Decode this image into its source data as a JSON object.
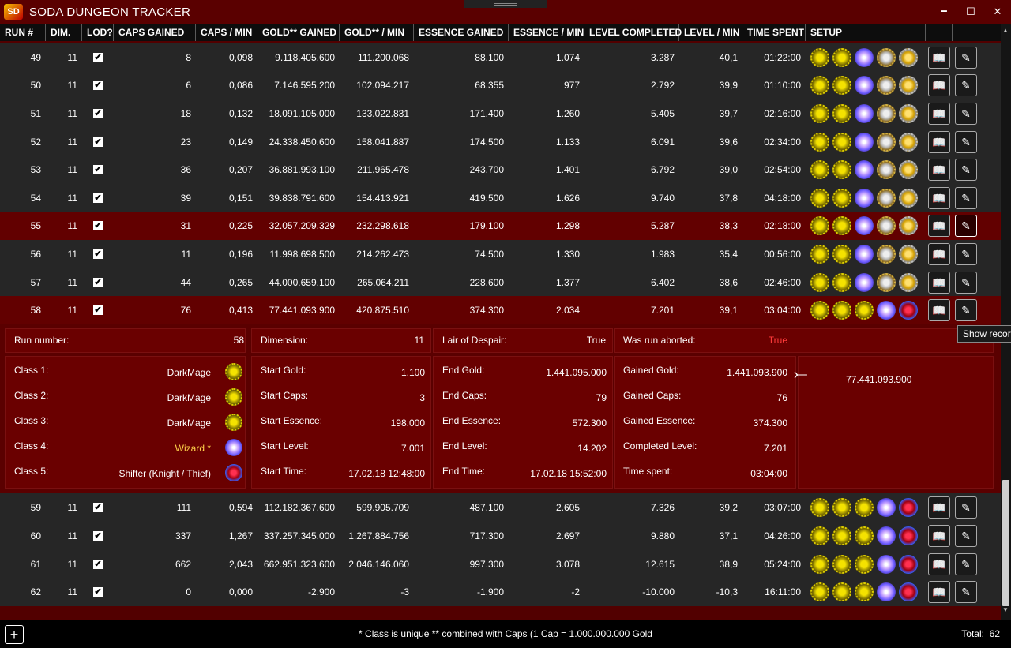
{
  "app": {
    "title": "SODA DUNGEON TRACKER",
    "logo": "SD"
  },
  "window": {
    "minimize": "🗕",
    "maximize": "☐",
    "close": "✕"
  },
  "columns": [
    "RUN #",
    "DIM.",
    "LOD?",
    "CAPS GAINED",
    "CAPS / MIN",
    "GOLD** GAINED",
    "GOLD** / MIN",
    "ESSENCE GAINED",
    "ESSENCE / MIN",
    "LEVEL COMPLETED",
    "LEVEL / MIN",
    "TIME SPENT",
    "SETUP"
  ],
  "rows": [
    {
      "run": "49",
      "dim": "11",
      "lod": true,
      "caps": "8",
      "caps_min": "0,098",
      "gold": "9.118.405.600",
      "gold_min": "111.200.068",
      "ess": "88.100",
      "ess_min": "1.074",
      "level": "3.287",
      "level_min": "40,1",
      "time": "01:22:00",
      "setup": [
        "gear",
        "gear",
        "orb",
        "shield",
        "wing"
      ]
    },
    {
      "run": "50",
      "dim": "11",
      "lod": true,
      "caps": "6",
      "caps_min": "0,086",
      "gold": "7.146.595.200",
      "gold_min": "102.094.217",
      "ess": "68.355",
      "ess_min": "977",
      "level": "2.792",
      "level_min": "39,9",
      "time": "01:10:00",
      "setup": [
        "gear",
        "gear",
        "orb",
        "shield",
        "wing"
      ]
    },
    {
      "run": "51",
      "dim": "11",
      "lod": true,
      "caps": "18",
      "caps_min": "0,132",
      "gold": "18.091.105.000",
      "gold_min": "133.022.831",
      "ess": "171.400",
      "ess_min": "1.260",
      "level": "5.405",
      "level_min": "39,7",
      "time": "02:16:00",
      "setup": [
        "gear",
        "gear",
        "orb",
        "shield",
        "wing"
      ]
    },
    {
      "run": "52",
      "dim": "11",
      "lod": true,
      "caps": "23",
      "caps_min": "0,149",
      "gold": "24.338.450.600",
      "gold_min": "158.041.887",
      "ess": "174.500",
      "ess_min": "1.133",
      "level": "6.091",
      "level_min": "39,6",
      "time": "02:34:00",
      "setup": [
        "gear",
        "gear",
        "orb",
        "shield",
        "wing"
      ]
    },
    {
      "run": "53",
      "dim": "11",
      "lod": true,
      "caps": "36",
      "caps_min": "0,207",
      "gold": "36.881.993.100",
      "gold_min": "211.965.478",
      "ess": "243.700",
      "ess_min": "1.401",
      "level": "6.792",
      "level_min": "39,0",
      "time": "02:54:00",
      "setup": [
        "gear",
        "gear",
        "orb",
        "shield",
        "wing"
      ]
    },
    {
      "run": "54",
      "dim": "11",
      "lod": true,
      "caps": "39",
      "caps_min": "0,151",
      "gold": "39.838.791.600",
      "gold_min": "154.413.921",
      "ess": "419.500",
      "ess_min": "1.626",
      "level": "9.740",
      "level_min": "37,8",
      "time": "04:18:00",
      "setup": [
        "gear",
        "gear",
        "orb",
        "shield",
        "wing"
      ]
    },
    {
      "run": "55",
      "dim": "11",
      "lod": true,
      "caps": "31",
      "caps_min": "0,225",
      "gold": "32.057.209.329",
      "gold_min": "232.298.618",
      "ess": "179.100",
      "ess_min": "1.298",
      "level": "5.287",
      "level_min": "38,3",
      "time": "02:18:00",
      "setup": [
        "gear",
        "gear",
        "orb",
        "shield",
        "wing"
      ]
    },
    {
      "run": "56",
      "dim": "11",
      "lod": true,
      "caps": "11",
      "caps_min": "0,196",
      "gold": "11.998.698.500",
      "gold_min": "214.262.473",
      "ess": "74.500",
      "ess_min": "1.330",
      "level": "1.983",
      "level_min": "35,4",
      "time": "00:56:00",
      "setup": [
        "gear",
        "gear",
        "orb",
        "shield",
        "wing"
      ]
    },
    {
      "run": "57",
      "dim": "11",
      "lod": true,
      "caps": "44",
      "caps_min": "0,265",
      "gold": "44.000.659.100",
      "gold_min": "265.064.211",
      "ess": "228.600",
      "ess_min": "1.377",
      "level": "6.402",
      "level_min": "38,6",
      "time": "02:46:00",
      "setup": [
        "gear",
        "gear",
        "orb",
        "shield",
        "wing"
      ]
    },
    {
      "run": "58",
      "dim": "11",
      "lod": true,
      "caps": "76",
      "caps_min": "0,413",
      "gold": "77.441.093.900",
      "gold_min": "420.875.510",
      "ess": "374.300",
      "ess_min": "2.034",
      "level": "7.201",
      "level_min": "39,1",
      "time": "03:04:00",
      "setup": [
        "gear",
        "gear",
        "gear",
        "orb",
        "eye"
      ]
    },
    {
      "run": "59",
      "dim": "11",
      "lod": true,
      "caps": "111",
      "caps_min": "0,594",
      "gold": "112.182.367.600",
      "gold_min": "599.905.709",
      "ess": "487.100",
      "ess_min": "2.605",
      "level": "7.326",
      "level_min": "39,2",
      "time": "03:07:00",
      "setup": [
        "gear",
        "gear",
        "gear",
        "orb",
        "eye"
      ]
    },
    {
      "run": "60",
      "dim": "11",
      "lod": true,
      "caps": "337",
      "caps_min": "1,267",
      "gold": "337.257.345.000",
      "gold_min": "1.267.884.756",
      "ess": "717.300",
      "ess_min": "2.697",
      "level": "9.880",
      "level_min": "37,1",
      "time": "04:26:00",
      "setup": [
        "gear",
        "gear",
        "gear",
        "orb",
        "eye"
      ]
    },
    {
      "run": "61",
      "dim": "11",
      "lod": true,
      "caps": "662",
      "caps_min": "2,043",
      "gold": "662.951.323.600",
      "gold_min": "2.046.146.060",
      "ess": "997.300",
      "ess_min": "3.078",
      "level": "12.615",
      "level_min": "38,9",
      "time": "05:24:00",
      "setup": [
        "gear",
        "gear",
        "gear",
        "orb",
        "eye"
      ]
    },
    {
      "run": "62",
      "dim": "11",
      "lod": true,
      "caps": "0",
      "caps_min": "0,000",
      "gold": "-2.900",
      "gold_min": "-3",
      "ess": "-1.900",
      "ess_min": "-2",
      "level": "-10.000",
      "level_min": "-10,3",
      "time": "16:11:00",
      "setup": [
        "gear",
        "gear",
        "gear",
        "orb",
        "eye"
      ]
    }
  ],
  "row_actions": {
    "book_icon": "📖",
    "edit_icon": "✎"
  },
  "detail": {
    "run_label": "Run number:",
    "run_value": "58",
    "dim_label": "Dimension:",
    "dim_value": "11",
    "lod_label": "Lair of Despair:",
    "lod_value": "True",
    "aborted_label": "Was run aborted:",
    "aborted_value": "True",
    "class1_label": "Class 1:",
    "class1": "DarkMage",
    "class2_label": "Class 2:",
    "class2": "DarkMage",
    "class3_label": "Class 3:",
    "class3": "DarkMage",
    "class4_label": "Class 4:",
    "class4": "Wizard *",
    "class5_label": "Class 5:",
    "class5": "Shifter (Knight / Thief)",
    "start_gold_label": "Start Gold:",
    "start_gold": "1.100",
    "start_caps_label": "Start Caps:",
    "start_caps": "3",
    "start_ess_label": "Start Essence:",
    "start_ess": "198.000",
    "start_level_label": "Start Level:",
    "start_level": "7.001",
    "start_time_label": "Start Time:",
    "start_time": "17.02.18 12:48:00",
    "end_gold_label": "End Gold:",
    "end_gold": "1.441.095.000",
    "end_caps_label": "End Caps:",
    "end_caps": "79",
    "end_ess_label": "End Essence:",
    "end_ess": "572.300",
    "end_level_label": "End Level:",
    "end_level": "14.202",
    "end_time_label": "End Time:",
    "end_time": "17.02.18 15:52:00",
    "gained_gold_label": "Gained Gold:",
    "gained_gold": "1.441.093.900",
    "gained_caps_label": "Gained Caps:",
    "gained_caps": "76",
    "gained_ess_label": "Gained Essence:",
    "gained_ess": "374.300",
    "completed_level_label": "Completed Level:",
    "completed_level": "7.201",
    "time_spent_label": "Time spent:",
    "time_spent": "03:04:00",
    "combined_gold": "77.441.093.900",
    "merge_icon": "⤚"
  },
  "tooltip": "Show record",
  "footer": {
    "add_label": "+",
    "note": "* Class is unique    ** combined with Caps (1 Cap = 1.000.000.000 Gold",
    "total_label": "Total:",
    "total_value": "62"
  }
}
